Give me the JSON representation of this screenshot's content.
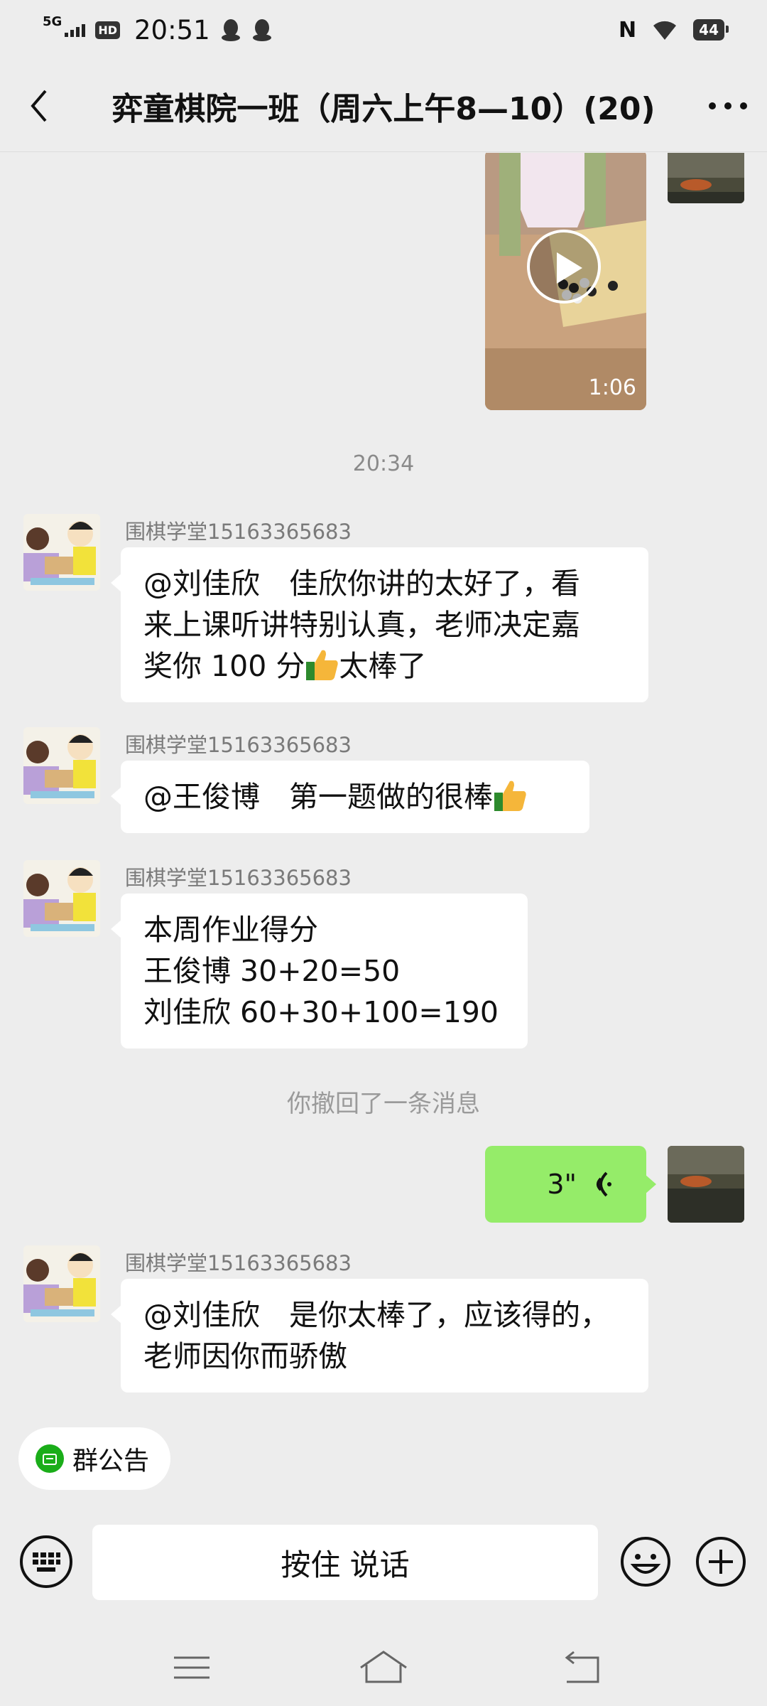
{
  "status_bar": {
    "network": "5G",
    "hd": "HD",
    "time": "20:51",
    "nfc": "N",
    "battery": "44"
  },
  "header": {
    "title": "弈童棋院一班（周六上午8—10）(20)"
  },
  "video": {
    "duration": "1:06"
  },
  "timestamp": "20:34",
  "messages": [
    {
      "sender": "围棋学堂15163365683",
      "lines": [
        "@刘佳欣　佳欣你讲的太好了，看",
        "来上课听讲特别认真，老师决定嘉",
        "奖你 100 分",
        "太棒了"
      ]
    },
    {
      "sender": "围棋学堂15163365683",
      "lines": [
        "@王俊博　第一题做的很棒"
      ]
    },
    {
      "sender": "围棋学堂15163365683",
      "lines": [
        "本周作业得分",
        "王俊博 30+20=50",
        "刘佳欣 60+30+100=190"
      ]
    },
    {
      "sender": "围棋学堂15163365683",
      "lines": [
        "@刘佳欣　是你太棒了，应该得的，",
        "老师因你而骄傲"
      ]
    }
  ],
  "recall_notice": "你撤回了一条消息",
  "voice": {
    "duration": "3\""
  },
  "announcement": {
    "label": "群公告"
  },
  "input": {
    "talk_label": "按住 说话"
  },
  "colors": {
    "background": "#ededed",
    "self_bubble": "#95ec69",
    "other_bubble": "#ffffff",
    "announcement_icon": "#1aad19"
  },
  "icons": [
    "back-icon",
    "more-icon",
    "play-icon",
    "voice-wave-icon",
    "announcement-icon",
    "keyboard-icon",
    "emoji-icon",
    "plus-icon",
    "menu-icon",
    "home-icon",
    "return-icon",
    "thumbs-up-icon"
  ]
}
